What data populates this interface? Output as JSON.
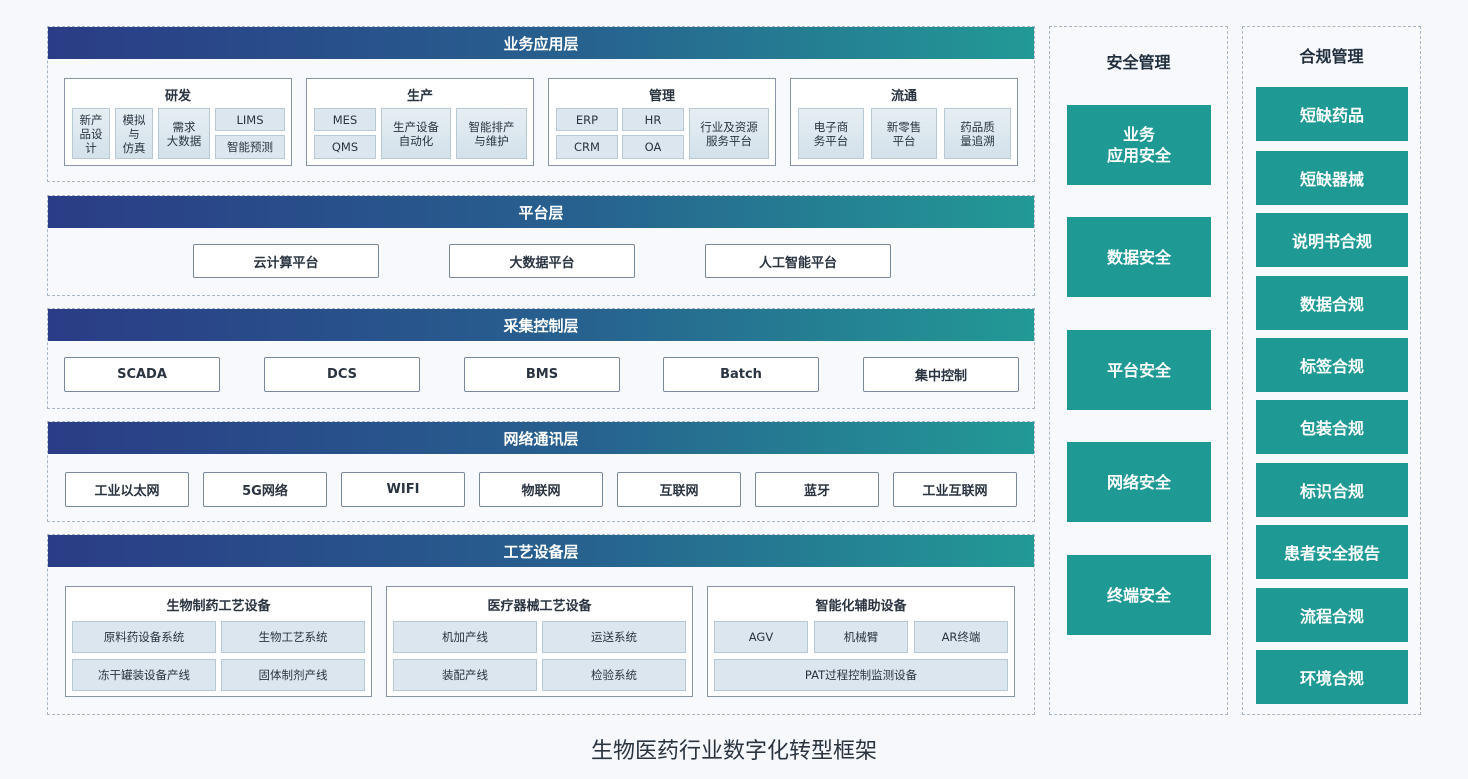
{
  "layers": {
    "business": {
      "title": "业务应用层",
      "groups": [
        {
          "title": "研发",
          "cells": [
            "新产\n品设\n计",
            "模拟\n与\n仿真",
            "需求\n大数据",
            "LIMS",
            "智能预测"
          ]
        },
        {
          "title": "生产",
          "cells": [
            "MES",
            "QMS",
            "生产设备\n自动化",
            "智能排产\n与维护"
          ]
        },
        {
          "title": "管理",
          "cells": [
            "ERP",
            "HR",
            "CRM",
            "OA",
            "行业及资源\n服务平台"
          ]
        },
        {
          "title": "流通",
          "cells": [
            "电子商\n务平台",
            "新零售\n平台",
            "药品质\n量追溯"
          ]
        }
      ]
    },
    "platform": {
      "title": "平台层",
      "items": [
        "云计算平台",
        "大数据平台",
        "人工智能平台"
      ]
    },
    "collection": {
      "title": "采集控制层",
      "items": [
        "SCADA",
        "DCS",
        "BMS",
        "Batch",
        "集中控制"
      ]
    },
    "network": {
      "title": "网络通讯层",
      "items": [
        "工业以太网",
        "5G网络",
        "WIFI",
        "物联网",
        "互联网",
        "蓝牙",
        "工业互联网"
      ]
    },
    "equipment": {
      "title": "工艺设备层",
      "groups": [
        {
          "title": "生物制药工艺设备",
          "cells": [
            "原料药设备系统",
            "生物工艺系统",
            "冻干罐装设备产线",
            "固体制剂产线"
          ]
        },
        {
          "title": "医疗器械工艺设备",
          "cells": [
            "机加产线",
            "运送系统",
            "装配产线",
            "检验系统"
          ]
        },
        {
          "title": "智能化辅助设备",
          "cells": [
            "AGV",
            "机械臂",
            "AR终端",
            "PAT过程控制监测设备"
          ]
        }
      ]
    }
  },
  "security": {
    "title": "安全管理",
    "items": [
      "业务\n应用安全",
      "数据安全",
      "平台安全",
      "网络安全",
      "终端安全"
    ]
  },
  "compliance": {
    "title": "合规管理",
    "items": [
      "短缺药品",
      "短缺器械",
      "说明书合规",
      "数据合规",
      "标签合规",
      "包装合规",
      "标识合规",
      "患者安全报告",
      "流程合规",
      "环境合规"
    ]
  },
  "caption": "生物医药行业数字化转型框架",
  "colors": {
    "header_gradient_start": "#2a3c86",
    "header_gradient_end": "#229a96",
    "teal": "#1f9994"
  }
}
